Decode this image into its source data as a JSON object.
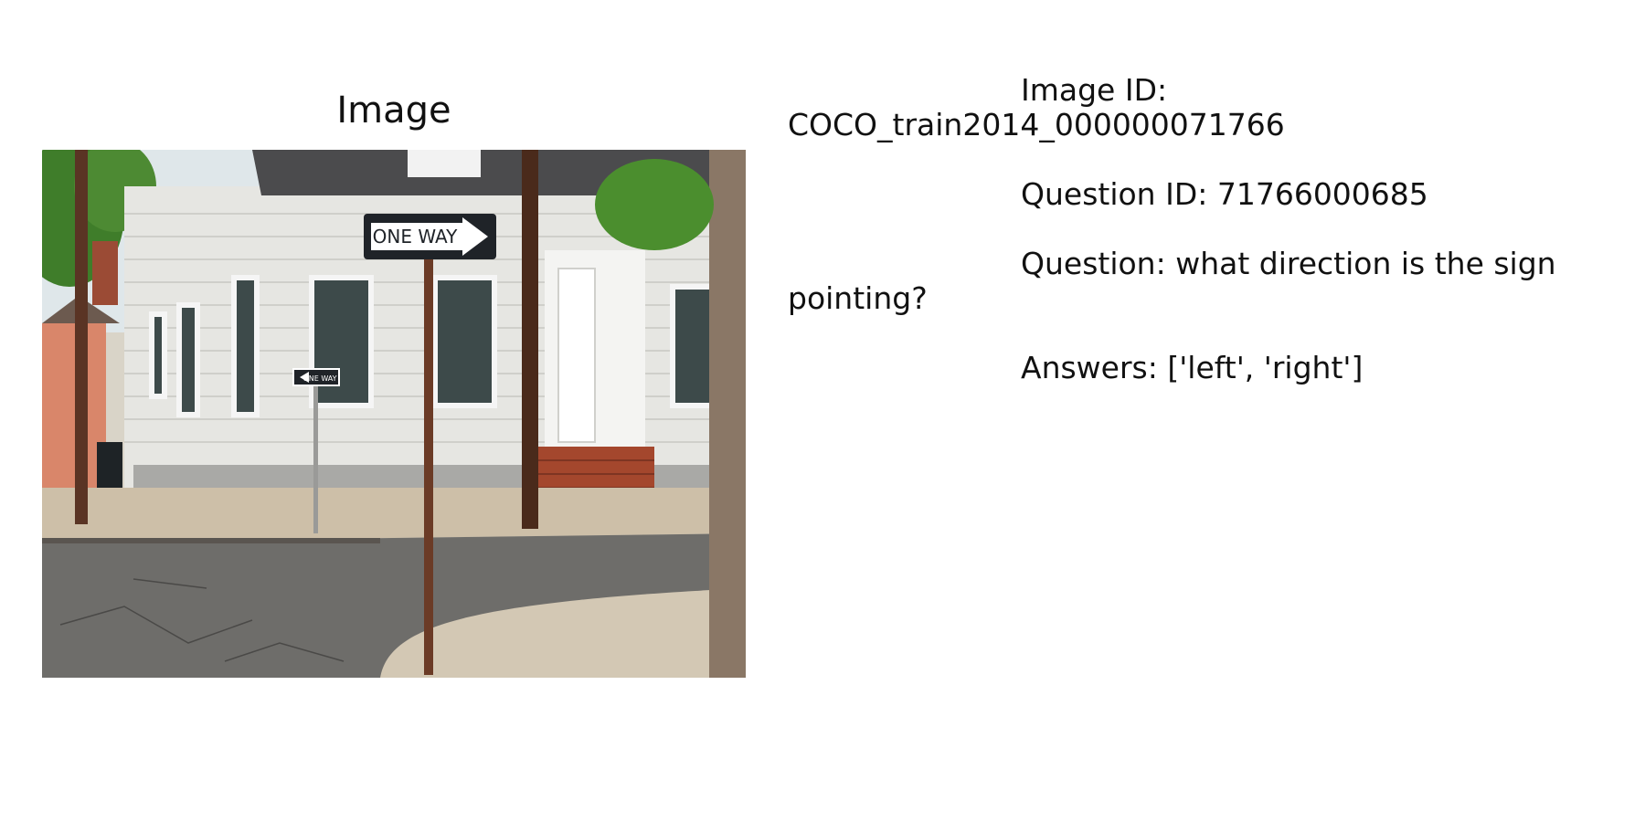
{
  "panel": {
    "title": "Image"
  },
  "photo": {
    "sign_large_text": "ONE WAY",
    "sign_small_text": "ONE WAY",
    "colors": {
      "sky": "#dfe7ea",
      "siding": "#e6e6e2",
      "roof": "#4b4b4d",
      "road": "#6e6d6a",
      "sidewalk": "#cdbfa8",
      "sign": "#1f2328",
      "pole": "#5a3424",
      "steps": "#a4472d",
      "foliage": "#3f7d2a"
    }
  },
  "info": {
    "image_id": "Image ID: COCO_train2014_000000071766",
    "question_id": "Question ID: 71766000685",
    "question": "Question: what direction is the sign pointing?",
    "answers": "Answers: ['left', 'right']"
  }
}
